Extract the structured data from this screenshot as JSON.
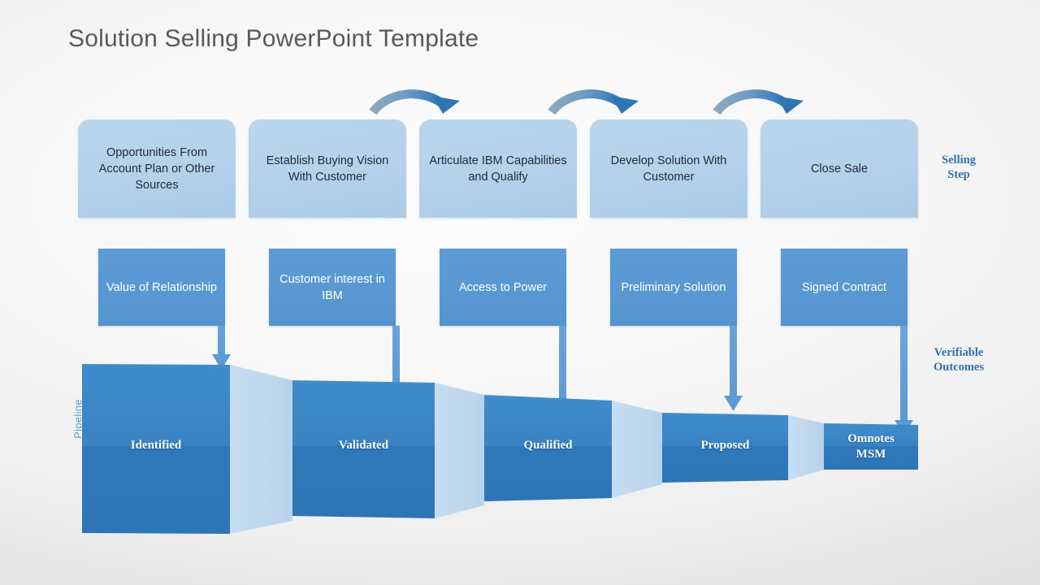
{
  "slide": {
    "title": "Solution Selling PowerPoint Template",
    "background_color": "#f2f2f2"
  },
  "colors": {
    "step_box": "#b3d1ea",
    "outcome_box": "#5b9bd5",
    "funnel_top": "#3a86c8",
    "funnel_bottom": "#2e75b6",
    "connector": "#bdd7ee",
    "accent_label": "#2f6fad",
    "pipeline_label": "#5b9bd5",
    "title_text": "#595959",
    "arrow": "#5b9bd5"
  },
  "rows": {
    "selling_steps": {
      "label": "Selling\nStep",
      "label_line1": "Selling",
      "label_line2": "Step",
      "items": [
        {
          "text": "Opportunities From  Account Plan or  Other Sources"
        },
        {
          "text": "Establish Buying Vision With Customer"
        },
        {
          "text": "Articulate IBM Capabilities and Qualify"
        },
        {
          "text": "Develop Solution With Customer"
        },
        {
          "text": "Close Sale"
        }
      ]
    },
    "verifiable_outcomes": {
      "label_line1": "Verifiable",
      "label_line2": "Outcomes",
      "items": [
        {
          "text": "Value of Relationship"
        },
        {
          "text": "Customer interest in IBM"
        },
        {
          "text": "Access to Power"
        },
        {
          "text": "Preliminary Solution"
        },
        {
          "text": "Signed Contract"
        }
      ]
    },
    "pipeline": {
      "label": "Pipeline",
      "stages": [
        {
          "text": "Identified"
        },
        {
          "text": "Validated"
        },
        {
          "text": "Qualified"
        },
        {
          "text": "Proposed"
        },
        {
          "text": "Omnotes\nMSM"
        }
      ]
    }
  },
  "connectors": {
    "curved_arrow_count": 3,
    "down_arrow_count": 5
  }
}
